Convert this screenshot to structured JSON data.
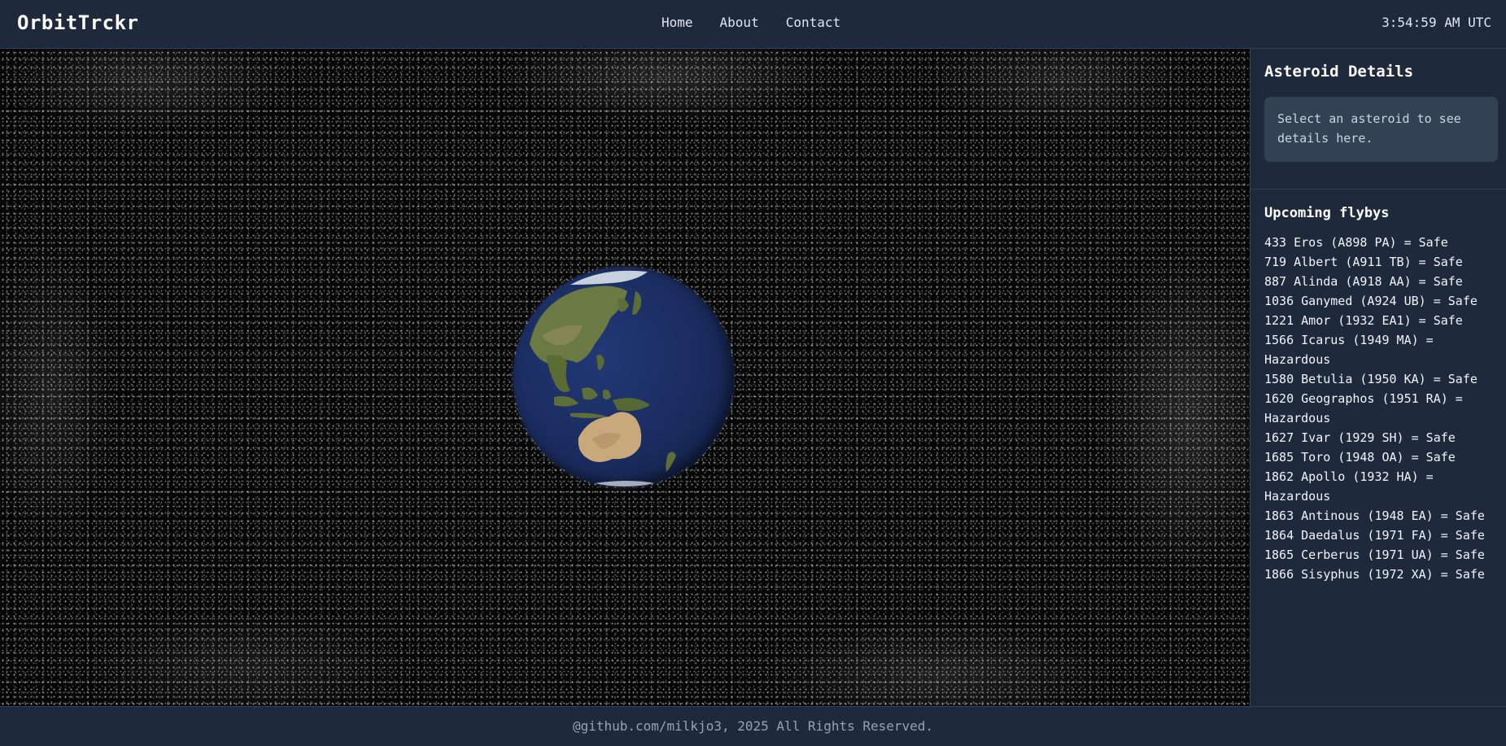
{
  "header": {
    "brand": "OrbitTrckr",
    "nav": [
      {
        "label": "Home"
      },
      {
        "label": "About"
      },
      {
        "label": "Contact"
      }
    ],
    "clock": "3:54:59 AM UTC"
  },
  "viewport": {
    "globe_icon": "earth-globe"
  },
  "sidebar": {
    "details_title": "Asteroid Details",
    "details_placeholder": "Select an asteroid to see details here.",
    "flybys_title": "Upcoming flybys",
    "flybys": [
      {
        "label": "433 Eros (A898 PA) = Safe"
      },
      {
        "label": "719 Albert (A911 TB) = Safe"
      },
      {
        "label": "887 Alinda (A918 AA) = Safe"
      },
      {
        "label": "1036 Ganymed (A924 UB) = Safe"
      },
      {
        "label": "1221 Amor (1932 EA1) = Safe"
      },
      {
        "label": "1566 Icarus (1949 MA) = Hazardous"
      },
      {
        "label": "1580 Betulia (1950 KA) = Safe"
      },
      {
        "label": "1620 Geographos (1951 RA) = Hazardous"
      },
      {
        "label": "1627 Ivar (1929 SH) = Safe"
      },
      {
        "label": "1685 Toro (1948 OA) = Safe"
      },
      {
        "label": "1862 Apollo (1932 HA) = Hazardous"
      },
      {
        "label": "1863 Antinous (1948 EA) = Safe"
      },
      {
        "label": "1864 Daedalus (1971 FA) = Safe"
      },
      {
        "label": "1865 Cerberus (1971 UA) = Safe"
      },
      {
        "label": "1866 Sisyphus (1972 XA) = Safe"
      }
    ]
  },
  "footer": {
    "text": "@github.com/milkjo3, 2025 All Rights Reserved."
  },
  "colors": {
    "background": "#1e293b",
    "panel": "#334155",
    "text": "#e2e8f0",
    "ocean": "#1a2c5e",
    "land": "#5f6f3a",
    "desert": "#c8a77a"
  }
}
